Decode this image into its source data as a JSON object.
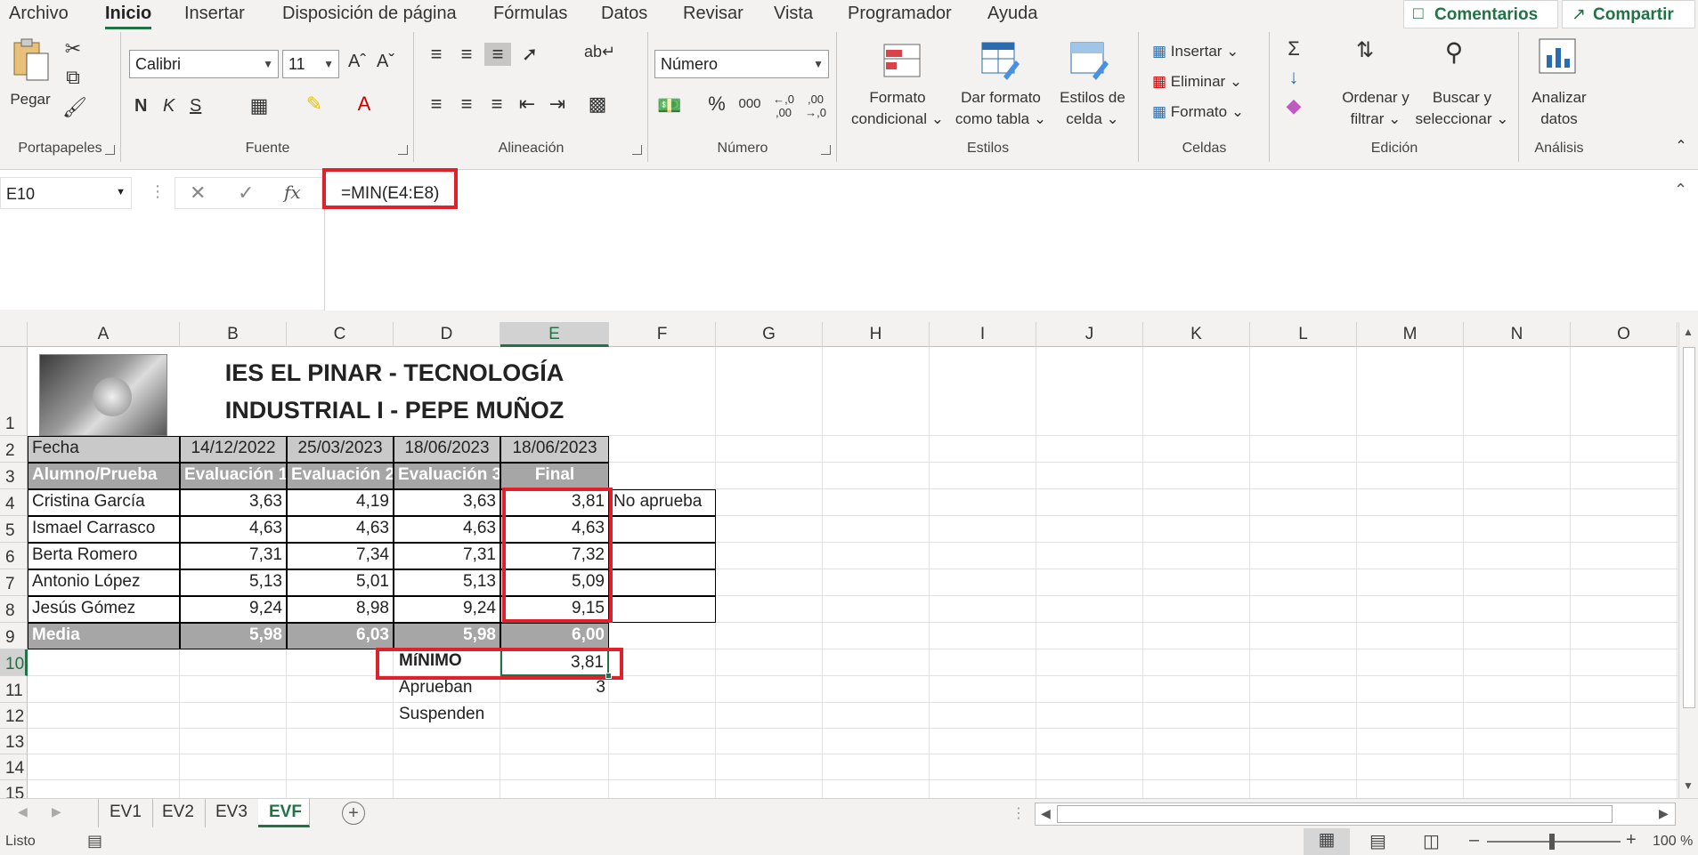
{
  "ribbon_tabs": [
    "Archivo",
    "Inicio",
    "Insertar",
    "Disposición de página",
    "Fórmulas",
    "Datos",
    "Revisar",
    "Vista",
    "Programador",
    "Ayuda"
  ],
  "active_tab": "Inicio",
  "top_buttons": {
    "comments": "Comentarios",
    "share": "Compartir"
  },
  "ribbon": {
    "clipboard": {
      "paste": "Pegar",
      "label": "Portapapeles"
    },
    "font": {
      "name": "Calibri",
      "size": "11",
      "bold": "N",
      "italic": "K",
      "underline": "S",
      "label": "Fuente"
    },
    "alignment": {
      "label": "Alineación"
    },
    "number": {
      "format": "Número",
      "label": "Número"
    },
    "styles": {
      "conditional_line1": "Formato",
      "conditional_line2": "condicional",
      "table_line1": "Dar formato",
      "table_line2": "como tabla",
      "cell_line1": "Estilos de",
      "cell_line2": "celda",
      "label": "Estilos"
    },
    "cells": {
      "insert": "Insertar",
      "delete": "Eliminar",
      "format": "Formato",
      "label": "Celdas"
    },
    "editing": {
      "sort_line1": "Ordenar y",
      "sort_line2": "filtrar",
      "find_line1": "Buscar y",
      "find_line2": "seleccionar",
      "label": "Edición"
    },
    "analysis": {
      "analyze_line1": "Analizar",
      "analyze_line2": "datos",
      "label": "Análisis"
    }
  },
  "formula_bar": {
    "name_box": "E10",
    "formula": "=MIN(E4:E8)",
    "fx": "fx"
  },
  "columns": [
    "A",
    "B",
    "C",
    "D",
    "E",
    "F",
    "G",
    "H",
    "I",
    "J",
    "K",
    "L",
    "M",
    "N",
    "O"
  ],
  "rows": [
    "1",
    "2",
    "3",
    "4",
    "5",
    "6",
    "7",
    "8",
    "9",
    "10",
    "11",
    "12",
    "13",
    "14",
    "15"
  ],
  "sheet": {
    "title_line1": "IES EL PINAR - TECNOLOGÍA",
    "title_line2": "INDUSTRIAL I - PEPE MUÑOZ",
    "date_label": "Fecha",
    "dates": [
      "14/12/2022",
      "25/03/2023",
      "18/06/2023",
      "18/06/2023"
    ],
    "header_label": "Alumno/Prueba",
    "headers": [
      "Evaluación 1",
      "Evaluación 2",
      "Evaluación 3",
      "Final"
    ],
    "students": [
      {
        "name": "Cristina García",
        "e1": "3,63",
        "e2": "4,19",
        "e3": "3,63",
        "final": "3,81",
        "note": "No aprueba"
      },
      {
        "name": "Ismael Carrasco",
        "e1": "4,63",
        "e2": "4,63",
        "e3": "4,63",
        "final": "4,63",
        "note": ""
      },
      {
        "name": "Berta Romero",
        "e1": "7,31",
        "e2": "7,34",
        "e3": "7,31",
        "final": "7,32",
        "note": ""
      },
      {
        "name": "Antonio López",
        "e1": "5,13",
        "e2": "5,01",
        "e3": "5,13",
        "final": "5,09",
        "note": ""
      },
      {
        "name": "Jesús Gómez",
        "e1": "9,24",
        "e2": "8,98",
        "e3": "9,24",
        "final": "9,15",
        "note": ""
      }
    ],
    "mean": {
      "label": "Media",
      "e1": "5,98",
      "e2": "6,03",
      "e3": "5,98",
      "final": "6,00"
    },
    "minimum": {
      "label": "MíNIMO",
      "value": "3,81"
    },
    "pass": {
      "label": "Aprueban",
      "value": "3"
    },
    "fail": {
      "label": "Suspenden",
      "value": ""
    }
  },
  "sheet_tabs": [
    "EV1",
    "EV2",
    "EV3",
    "EVF"
  ],
  "active_sheet": "EVF",
  "status": {
    "ready": "Listo",
    "zoom": "100 %"
  },
  "colors": {
    "accent": "#217346",
    "highlight": "#e0202a",
    "header_gray": "#a6a6a6"
  }
}
